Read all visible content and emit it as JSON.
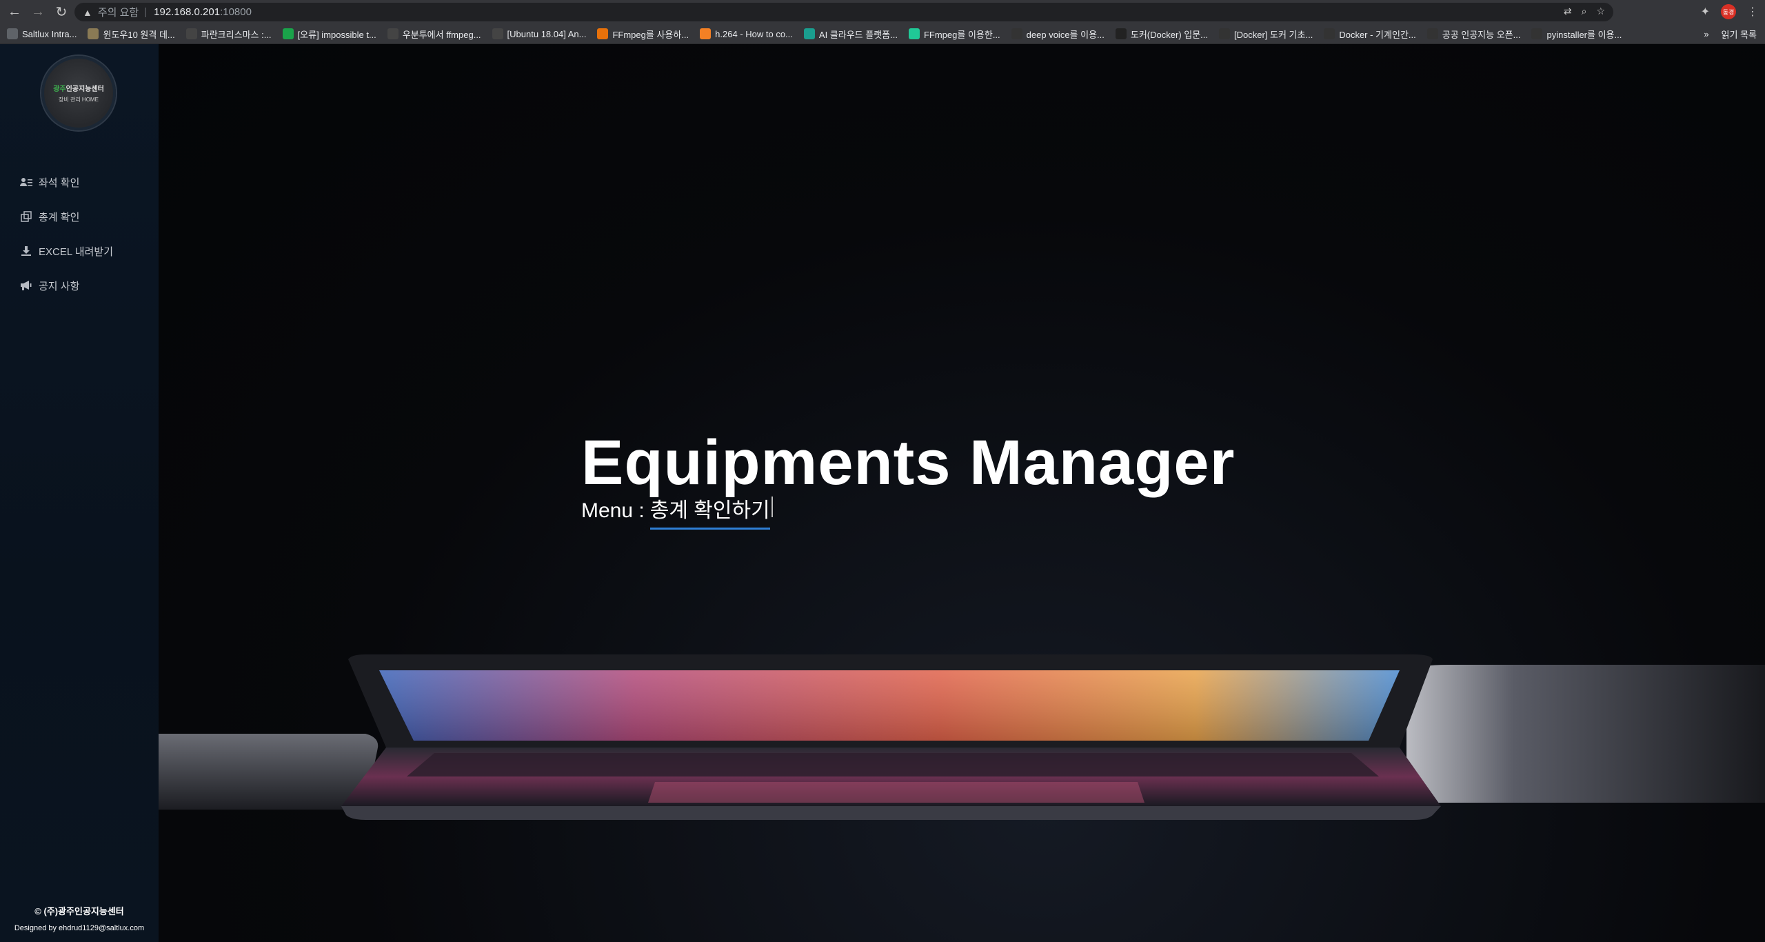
{
  "browser": {
    "security_warning": "주의 요함",
    "url_host": "192.168.0.201",
    "url_port": ":10800",
    "profile_initial": "동경"
  },
  "bookmarks": [
    {
      "label": "Saltlux Intra...",
      "icon": "saltlux-icon",
      "color": "#5f6368"
    },
    {
      "label": "윈도우10 원격 데...",
      "icon": "page-icon",
      "color": "#8a7a55"
    },
    {
      "label": "파란크리스마스 :...",
      "icon": "tistory-icon",
      "color": "#444"
    },
    {
      "label": "[오류] impossible t...",
      "icon": "chat-icon",
      "color": "#1aa34a"
    },
    {
      "label": "우분투에서 ffmpeg...",
      "icon": "tistory-icon",
      "color": "#444"
    },
    {
      "label": "[Ubuntu 18.04] An...",
      "icon": "tistory-icon",
      "color": "#444"
    },
    {
      "label": "FFmpeg를 사용하...",
      "icon": "dots-icon",
      "color": "#e8710a"
    },
    {
      "label": "h.264 - How to co...",
      "icon": "stack-icon",
      "color": "#f48024"
    },
    {
      "label": "AI 클라우드 플랫폼...",
      "icon": "person-icon",
      "color": "#1a9e8f"
    },
    {
      "label": "FFmpeg를 이용한...",
      "icon": "d-icon",
      "color": "#20c997"
    },
    {
      "label": "deep voice를 이용...",
      "icon": "voice-icon",
      "color": "#333"
    },
    {
      "label": "도커(Docker) 입문...",
      "icon": "44-icon",
      "color": "#222"
    },
    {
      "label": "[Docker] 도커 기초...",
      "icon": "b-icon",
      "color": "#333"
    },
    {
      "label": "Docker - 기계인간...",
      "icon": "grid-icon",
      "color": "#333"
    },
    {
      "label": "공공 인공지능 오픈...",
      "icon": "globe-icon",
      "color": "#333"
    },
    {
      "label": "pyinstaller를 이용...",
      "icon": "cloud-icon",
      "color": "#333"
    }
  ],
  "bookmarks_more": "»",
  "reading_list": "읽기 목록",
  "logo": {
    "line1_prefix": "광주",
    "line1_rest": "인공지능센터",
    "line2": "장비 관리 HOME"
  },
  "menu": [
    {
      "label": "좌석 확인",
      "icon": "user-list-icon"
    },
    {
      "label": "총계 확인",
      "icon": "copy-icon"
    },
    {
      "label": "EXCEL 내려받기",
      "icon": "download-icon"
    },
    {
      "label": "공지 사항",
      "icon": "megaphone-icon"
    }
  ],
  "footer": {
    "copyright": "© (주)광주인공지능센터",
    "designed_by": "Designed by ehdrud1129@saltlux.com"
  },
  "hero": {
    "title": "Equipments Manager",
    "menu_label": "Menu :",
    "menu_value": "총계 확인하기"
  }
}
